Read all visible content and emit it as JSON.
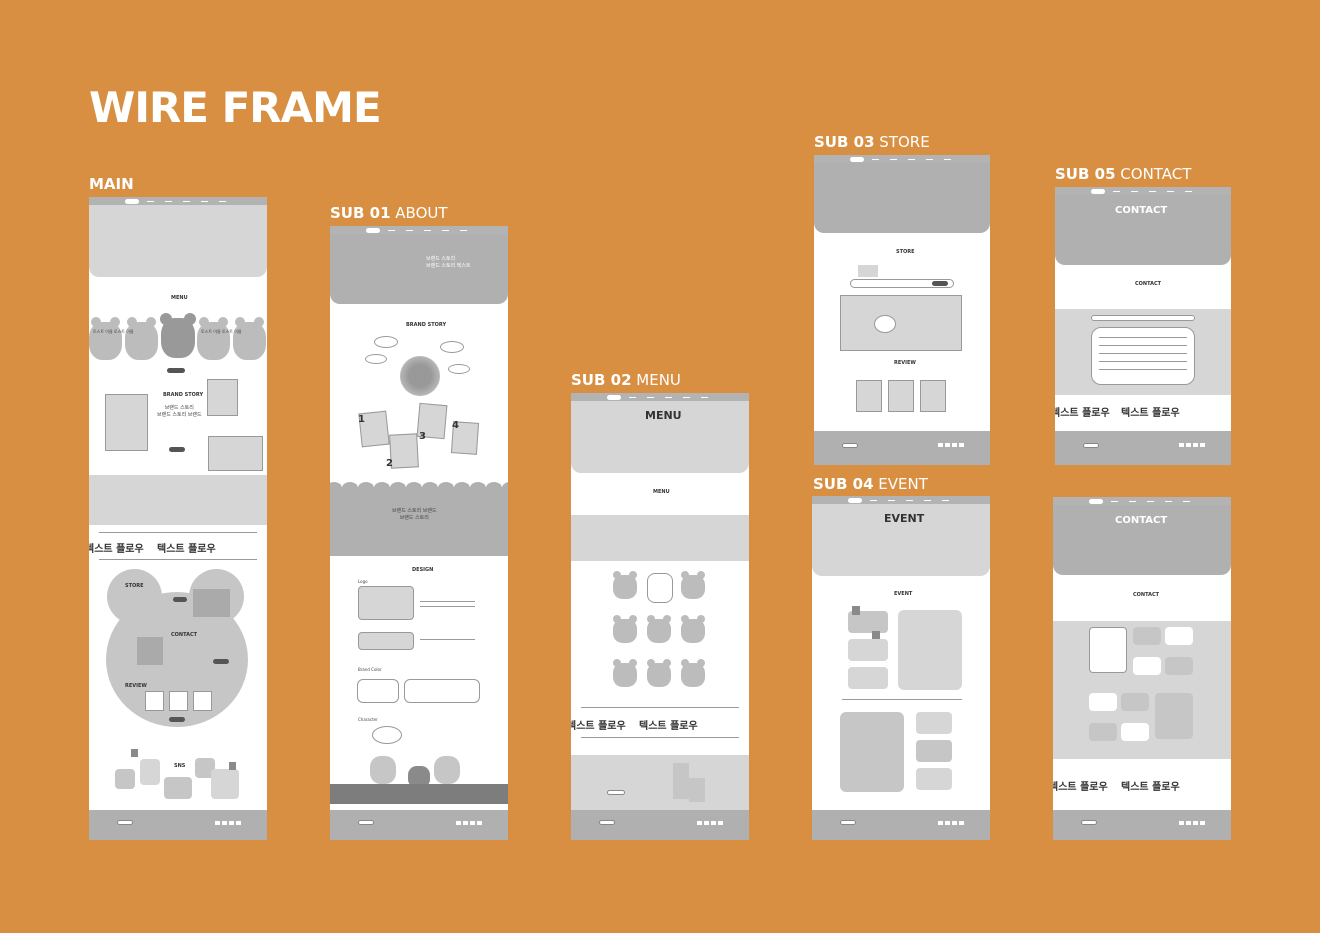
{
  "page_title": "WIRE FRAME",
  "sections": {
    "main": {
      "tag": "MAIN"
    },
    "sub01": {
      "tag": "SUB 01",
      "name": "ABOUT"
    },
    "sub02": {
      "tag": "SUB 02",
      "name": "MENU"
    },
    "sub03": {
      "tag": "SUB 03",
      "name": "STORE"
    },
    "sub04": {
      "tag": "SUB 04",
      "name": "EVENT"
    },
    "sub05": {
      "tag": "SUB 05",
      "name": "CONTACT"
    }
  },
  "frames": {
    "main": {
      "menu_heading": "MENU",
      "bear_text": "토스트 이름 토스트 이름",
      "brand_story": "BRAND STORY",
      "brand_story_body": "브랜드 스토리\n브랜드 스토리 브랜드",
      "marquee": "텍스트 플로우",
      "store": "STORE",
      "contact": "CONTACT",
      "review": "REVIEW",
      "sns": "SNS"
    },
    "sub01": {
      "hero_text": "브랜드 스토리\n브랜드 스토리 텍스트",
      "brand_story": "BRAND STORY",
      "quote_text": "브랜드 스토리 브랜드\n브랜드 스토리",
      "design": "DESIGN",
      "logo": "Logo",
      "brand_color": "Brand Color",
      "character": "Character",
      "nums": [
        "1",
        "2",
        "3",
        "4"
      ]
    },
    "sub02": {
      "hero_title": "MENU",
      "menu_heading": "MENU",
      "marquee": "텍스트 플로우"
    },
    "sub03": {
      "store": "STORE",
      "review": "REVIEW"
    },
    "sub04": {
      "hero_title": "EVENT",
      "event": "EVENT"
    },
    "sub05": {
      "hero_title": "CONTACT",
      "contact": "CONTACT",
      "marquee": "텍스트 플로우"
    },
    "sub05b": {
      "hero_title": "CONTACT",
      "contact": "CONTACT",
      "marquee": "텍스트 플로우"
    }
  },
  "colors": {
    "background": "#d88f41",
    "wire_gray": "#b3b3b3",
    "light_gray": "#d6d6d6"
  }
}
